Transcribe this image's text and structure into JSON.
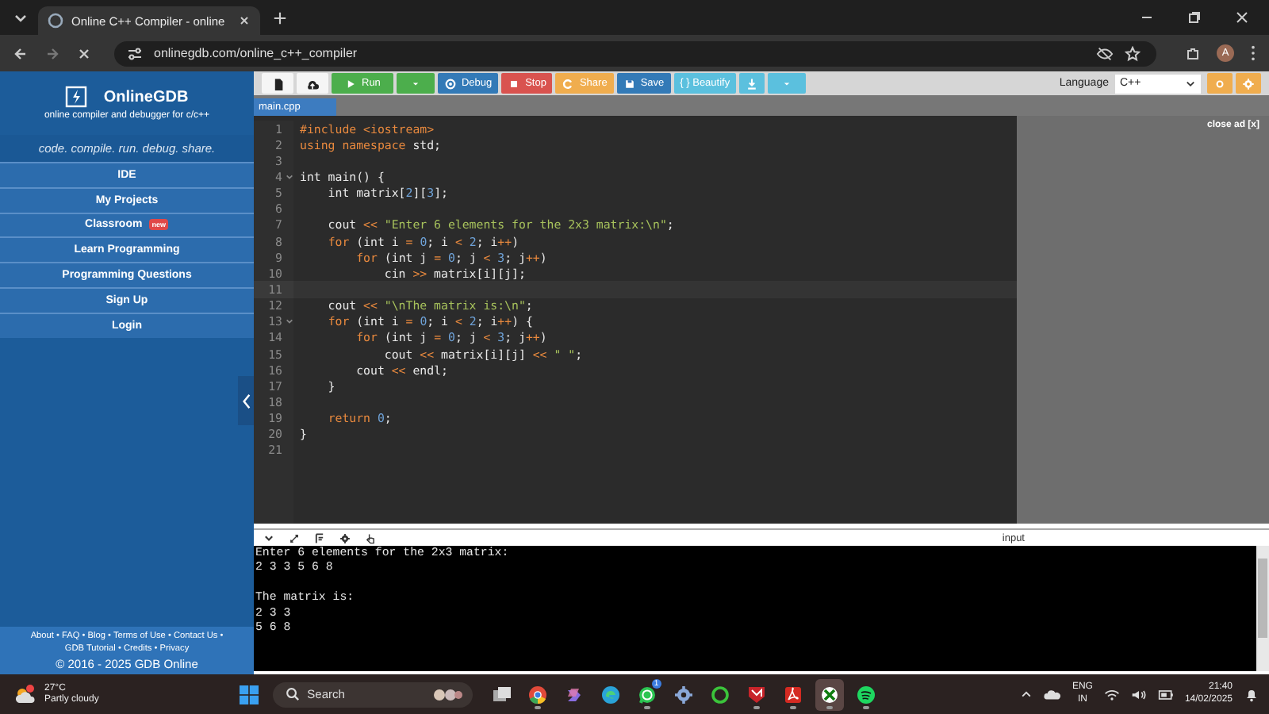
{
  "browser": {
    "tabs": [
      {
        "title": "Online C++ Compiler - online",
        "selected": true
      }
    ],
    "url": "onlinegdb.com/online_c++_compiler",
    "avatar": "A"
  },
  "sidebar": {
    "brand": "OnlineGDB",
    "subtitle": "online compiler and debugger for c/c++",
    "tagline": "code. compile. run. debug. share.",
    "nav": [
      {
        "label": "IDE"
      },
      {
        "label": "My Projects"
      },
      {
        "label": "Classroom",
        "badge": "new"
      },
      {
        "label": "Learn Programming"
      },
      {
        "label": "Programming Questions"
      },
      {
        "label": "Sign Up"
      },
      {
        "label": "Login"
      }
    ],
    "footer_links": [
      [
        "About",
        "FAQ",
        "Blog",
        "Terms of Use",
        "Contact Us"
      ],
      [
        "GDB Tutorial",
        "Credits",
        "Privacy"
      ]
    ],
    "separator": "•",
    "copyright": "© 2016 - 2025 GDB Online"
  },
  "toolbar": {
    "buttons": [
      {
        "kind": "new-file"
      },
      {
        "kind": "upload"
      },
      {
        "kind": "run",
        "label": "Run"
      },
      {
        "kind": "run-menu"
      },
      {
        "kind": "debug",
        "label": "Debug"
      },
      {
        "kind": "stop",
        "label": "Stop"
      },
      {
        "kind": "share",
        "label": "Share"
      },
      {
        "kind": "save",
        "label": "Save"
      },
      {
        "kind": "beautify",
        "label": "{ } Beautify"
      },
      {
        "kind": "download"
      },
      {
        "kind": "download-menu"
      }
    ],
    "language_label": "Language",
    "language": "C++",
    "extra_buttons": [
      {
        "kind": "theme"
      },
      {
        "kind": "settings"
      }
    ]
  },
  "editor": {
    "file_tab": "main.cpp",
    "lines": [
      {
        "n": "1",
        "fold": false,
        "active": false,
        "code": "#include <iostream>"
      },
      {
        "n": "2",
        "fold": false,
        "active": false,
        "code": "using namespace std;"
      },
      {
        "n": "3",
        "fold": false,
        "active": false
      },
      {
        "n": "4",
        "fold": true,
        "active": false,
        "code": "int main() {"
      },
      {
        "n": "5",
        "fold": false,
        "active": false,
        "code": "    int matrix[2][3];"
      },
      {
        "n": "6",
        "fold": false,
        "active": false
      },
      {
        "n": "7",
        "fold": false,
        "active": false,
        "code": "    cout << \"Enter 6 elements for the 2x3 matrix:\\n\";"
      },
      {
        "n": "8",
        "fold": false,
        "active": false,
        "code": "    for (int i = 0; i < 2; i++)"
      },
      {
        "n": "9",
        "fold": false,
        "active": false,
        "code": "        for (int j = 0; j < 3; j++)"
      },
      {
        "n": "10",
        "fold": false,
        "active": false,
        "code": "            cin >> matrix[i][j];"
      },
      {
        "n": "11",
        "fold": false,
        "active": true
      },
      {
        "n": "12",
        "fold": false,
        "active": false,
        "code": "    cout << \"\\nThe matrix is:\\n\";"
      },
      {
        "n": "13",
        "fold": true,
        "active": false,
        "code": "    for (int i = 0; i < 2; i++) {"
      },
      {
        "n": "14",
        "fold": false,
        "active": false,
        "code": "        for (int j = 0; j < 3; j++)"
      },
      {
        "n": "15",
        "fold": false,
        "active": false,
        "code": "            cout << matrix[i][j] << \" \";"
      },
      {
        "n": "16",
        "fold": false,
        "active": false,
        "code": "        cout << endl;"
      },
      {
        "n": "17",
        "fold": false,
        "active": false,
        "code": "    }"
      },
      {
        "n": "18",
        "fold": false,
        "active": false
      },
      {
        "n": "19",
        "fold": false,
        "active": false,
        "code": "    return 0;"
      },
      {
        "n": "20",
        "fold": false,
        "active": false,
        "code": "}"
      },
      {
        "n": "21",
        "fold": false,
        "active": false
      }
    ]
  },
  "ad": {
    "close": "close ad [x]"
  },
  "output": {
    "tools": [
      {
        "kind": "collapse"
      },
      {
        "kind": "expand"
      },
      {
        "kind": "format"
      },
      {
        "kind": "settings"
      },
      {
        "kind": "hand"
      }
    ],
    "mode": "input",
    "text": "Enter 6 elements for the 2x3 matrix:\n2 3 3 5 6 8\n\nThe matrix is:\n2 3 3\n5 6 8"
  },
  "taskbar": {
    "weather": {
      "temp": "27°C",
      "desc": "Partly cloudy"
    },
    "search": "Search",
    "apps": [
      {
        "kind": "task-view",
        "running": false,
        "active": false
      },
      {
        "kind": "chrome",
        "running": true,
        "active": false
      },
      {
        "kind": "copilot",
        "running": false,
        "active": false
      },
      {
        "kind": "edge",
        "running": false,
        "active": false
      },
      {
        "kind": "whatsapp",
        "running": true,
        "active": false,
        "badge": "1"
      },
      {
        "kind": "settings",
        "running": false,
        "active": false
      },
      {
        "kind": "ring",
        "running": false,
        "active": false
      },
      {
        "kind": "shield",
        "running": true,
        "active": false
      },
      {
        "kind": "acrobat",
        "running": true,
        "active": false
      },
      {
        "kind": "xbox",
        "running": true,
        "active": true
      },
      {
        "kind": "spotify",
        "running": true,
        "active": false
      }
    ],
    "lang": "ENG",
    "region": "IN",
    "time": "21:40",
    "date": "14/02/2025"
  }
}
